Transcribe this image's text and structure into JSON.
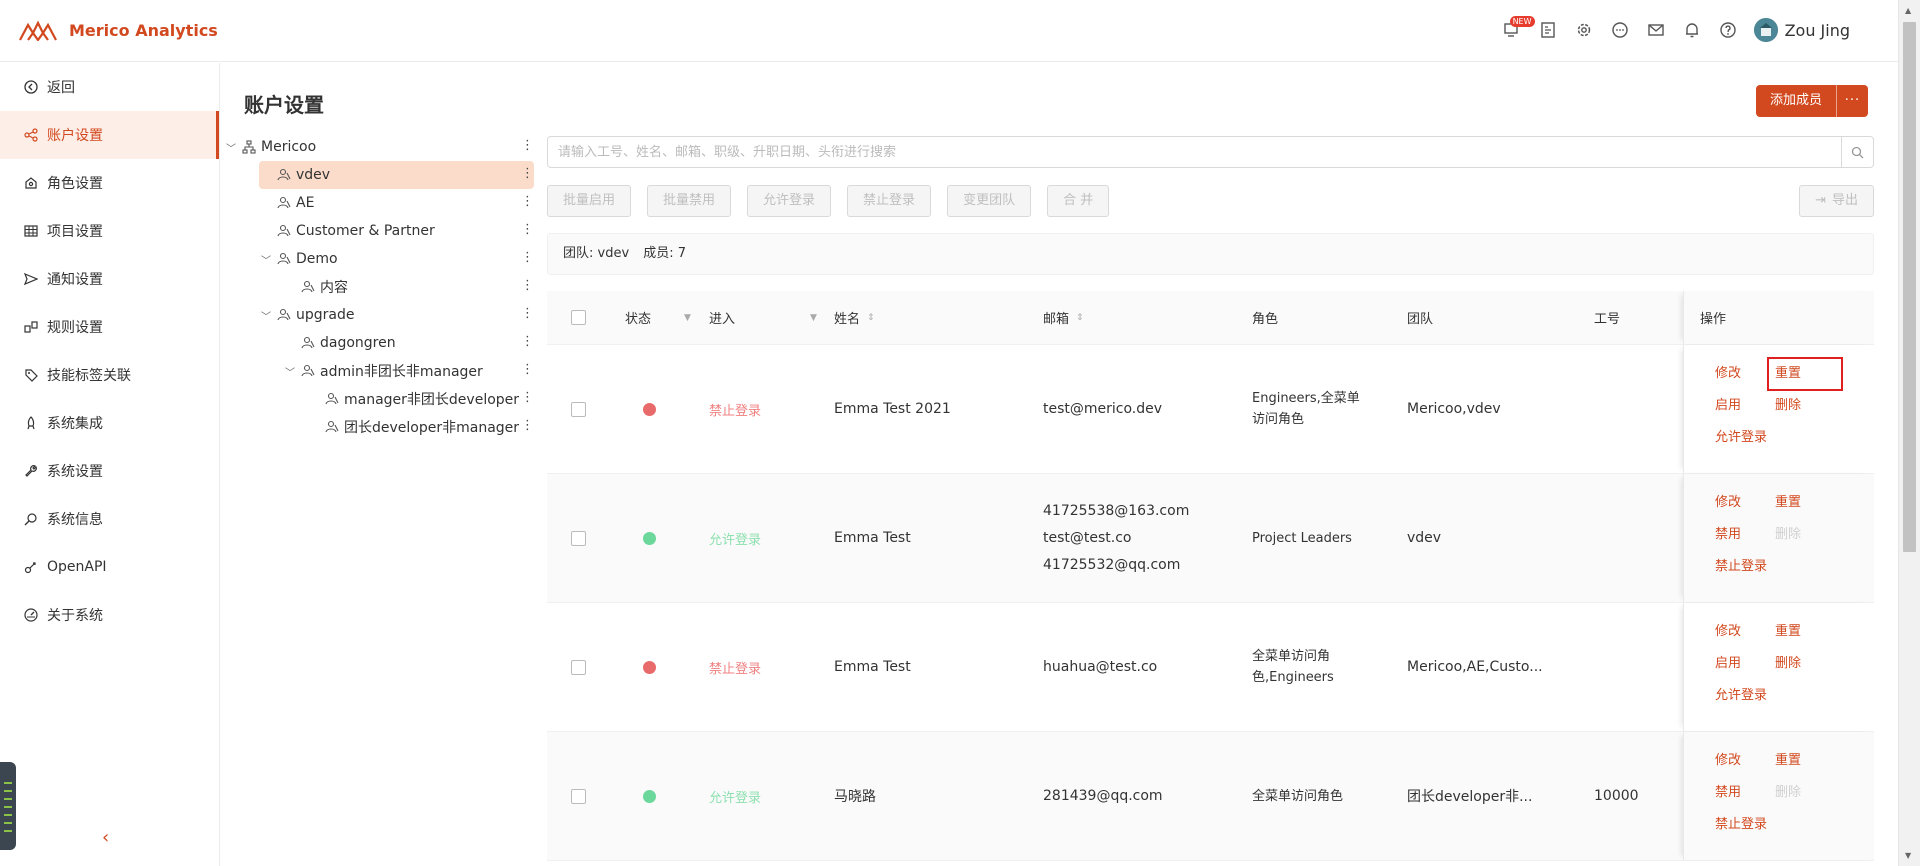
{
  "app": {
    "name": "Merico Analytics",
    "user": "Zou Jing",
    "new_badge": "NEW",
    "brand_color": "#d2491f"
  },
  "sidebar": {
    "items": [
      {
        "label": "返回",
        "icon": "back-circle-icon",
        "active": false
      },
      {
        "label": "账户设置",
        "icon": "account-share-icon",
        "active": true
      },
      {
        "label": "角色设置",
        "icon": "role-icon",
        "active": false
      },
      {
        "label": "项目设置",
        "icon": "table-grid-icon",
        "active": false
      },
      {
        "label": "通知设置",
        "icon": "send-icon",
        "active": false
      },
      {
        "label": "规则设置",
        "icon": "rules-icon",
        "active": false
      },
      {
        "label": "技能标签关联",
        "icon": "tag-icon",
        "active": false
      },
      {
        "label": "系统集成",
        "icon": "rocket-icon",
        "active": false
      },
      {
        "label": "系统设置",
        "icon": "wrench-icon",
        "active": false
      },
      {
        "label": "系统信息",
        "icon": "search-info-icon",
        "active": false
      },
      {
        "label": "OpenAPI",
        "icon": "api-icon",
        "active": false
      },
      {
        "label": "关于系统",
        "icon": "gauge-icon",
        "active": false
      }
    ]
  },
  "page": {
    "title": "账户设置",
    "add_label": "添加成员",
    "more_label": "···"
  },
  "tree": [
    {
      "label": "Mericoo",
      "level": 0,
      "expandable": true,
      "selected": false
    },
    {
      "label": "vdev",
      "level": 1,
      "expandable": false,
      "selected": true
    },
    {
      "label": "AE",
      "level": 1,
      "expandable": false,
      "selected": false
    },
    {
      "label": "Customer & Partner",
      "level": 1,
      "expandable": false,
      "selected": false
    },
    {
      "label": "Demo",
      "level": 1,
      "expandable": true,
      "selected": false
    },
    {
      "label": "内容",
      "level": 2,
      "expandable": false,
      "selected": false
    },
    {
      "label": "upgrade",
      "level": 1,
      "expandable": true,
      "selected": false
    },
    {
      "label": "dagongren",
      "level": 2,
      "expandable": false,
      "selected": false
    },
    {
      "label": "admin非团长非manager",
      "level": 2,
      "expandable": true,
      "selected": false
    },
    {
      "label": "manager非团长developer",
      "level": 3,
      "expandable": false,
      "selected": false
    },
    {
      "label": "团长developer非manager",
      "level": 3,
      "expandable": false,
      "selected": false
    }
  ],
  "search": {
    "placeholder": "请输入工号、姓名、邮箱、职级、升职日期、头衔进行搜索"
  },
  "toolbar": {
    "batch_enable": "批量启用",
    "batch_disable": "批量禁用",
    "allow_login": "允许登录",
    "forbid_login": "禁止登录",
    "change_team": "变更团队",
    "merge": "合 并",
    "export": "导出"
  },
  "info": {
    "team": "团队: vdev",
    "members": "成员: 7"
  },
  "columns": {
    "status": "状态",
    "enter": "进入",
    "name": "姓名",
    "email": "邮箱",
    "role": "角色",
    "team": "团队",
    "id": "工号",
    "ops": "操作"
  },
  "rows": [
    {
      "status": "red",
      "enter": "禁止登录",
      "name": "Emma Test 2021",
      "emails": [
        "test@merico.dev"
      ],
      "role": "Engineers,全菜单访问角色",
      "team": "Mericoo,vdev",
      "id": "",
      "ops": {
        "edit": "修改",
        "reset": "重置",
        "toggle": "启用",
        "delete": "删除",
        "login": "允许登录",
        "delete_disabled": false
      }
    },
    {
      "status": "green",
      "enter": "允许登录",
      "name": "Emma Test",
      "emails": [
        "41725538@163.com",
        "test@test.co",
        "41725532@qq.com"
      ],
      "role": "Project Leaders",
      "team": "vdev",
      "id": "",
      "ops": {
        "edit": "修改",
        "reset": "重置",
        "toggle": "禁用",
        "delete": "删除",
        "login": "禁止登录",
        "delete_disabled": true
      }
    },
    {
      "status": "red",
      "enter": "禁止登录",
      "name": "Emma Test",
      "emails": [
        "huahua@test.co"
      ],
      "role": "全菜单访问角色,Engineers",
      "team": "Mericoo,AE,Custo...",
      "id": "",
      "ops": {
        "edit": "修改",
        "reset": "重置",
        "toggle": "启用",
        "delete": "删除",
        "login": "允许登录",
        "delete_disabled": false
      }
    },
    {
      "status": "green",
      "enter": "允许登录",
      "name": "马晓路",
      "emails": [
        "281439@qq.com"
      ],
      "role": "全菜单访问角色",
      "team": "团长developer非...",
      "id": "10000",
      "ops": {
        "edit": "修改",
        "reset": "重置",
        "toggle": "禁用",
        "delete": "删除",
        "login": "禁止登录",
        "delete_disabled": true
      }
    }
  ]
}
